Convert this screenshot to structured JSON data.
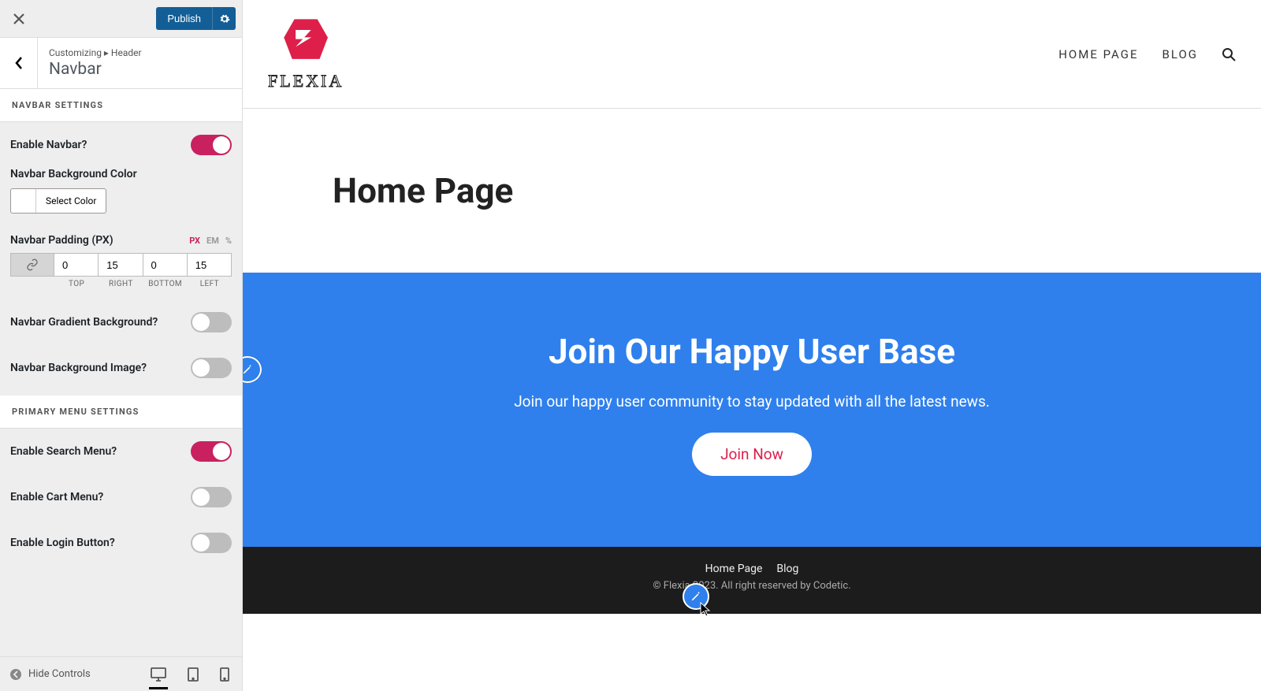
{
  "top": {
    "publish": "Publish"
  },
  "breadcrumb": {
    "path": "Customizing ▸ Header",
    "title": "Navbar"
  },
  "sections": {
    "navbar": "Navbar Settings",
    "primary": "Primary Menu Settings"
  },
  "controls": {
    "enable_navbar": "Enable Navbar?",
    "bg_color": "Navbar Background Color",
    "select_color": "Select Color",
    "padding_label": "Navbar Padding (PX)",
    "units": {
      "px": "PX",
      "em": "EM",
      "pct": "%"
    },
    "padding": {
      "top": "0",
      "right": "15",
      "bottom": "0",
      "left": "15"
    },
    "sub": {
      "top": "TOP",
      "right": "RIGHT",
      "bottom": "BOTTOM",
      "left": "LEFT"
    },
    "gradient": "Navbar Gradient Background?",
    "bg_image": "Navbar Background Image?",
    "search_menu": "Enable Search Menu?",
    "cart_menu": "Enable Cart Menu?",
    "login_btn": "Enable Login Button?"
  },
  "bottom": {
    "hide": "Hide Controls"
  },
  "preview": {
    "logo_text": "FLEXIA",
    "nav": {
      "home_upper": "HOME PAGE",
      "blog_upper": "BLOG"
    },
    "page_title": "Home Page",
    "hero": {
      "title": "Join Our Happy User Base",
      "subtitle": "Join our happy user community to stay updated with all the latest news.",
      "cta": "Join Now"
    },
    "footer": {
      "links": {
        "home": "Home Page",
        "blog": "Blog"
      },
      "copy": "© Flexia 2023. All right reserved by Codetic."
    }
  }
}
